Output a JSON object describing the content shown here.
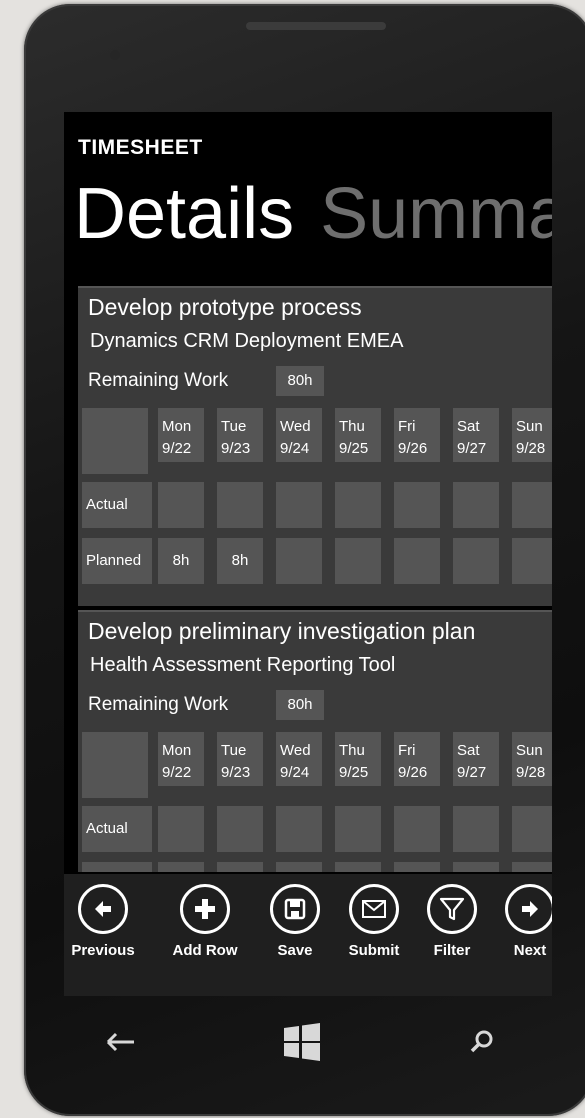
{
  "header": {
    "app_title": "TIMESHEET",
    "pivot_active": "Details",
    "pivot_next": "Summa"
  },
  "remaining_work_label": "Remaining Work",
  "row_labels": {
    "actual": "Actual",
    "planned": "Planned"
  },
  "days": [
    {
      "name": "Mon",
      "date": "9/22"
    },
    {
      "name": "Tue",
      "date": "9/23"
    },
    {
      "name": "Wed",
      "date": "9/24"
    },
    {
      "name": "Thu",
      "date": "9/25"
    },
    {
      "name": "Fri",
      "date": "9/26"
    },
    {
      "name": "Sat",
      "date": "9/27"
    },
    {
      "name": "Sun",
      "date": "9/28"
    }
  ],
  "tasks": [
    {
      "title": "Develop prototype process",
      "project": "Dynamics CRM Deployment EMEA",
      "remaining": "80h",
      "planned": [
        "8h",
        "8h",
        "",
        "",
        "",
        "",
        ""
      ],
      "actual": [
        "",
        "",
        "",
        "",
        "",
        "",
        ""
      ]
    },
    {
      "title": "Develop preliminary investigation plan",
      "project": "Health Assessment Reporting Tool",
      "remaining": "80h",
      "planned": [
        "",
        "",
        "",
        "",
        "",
        "",
        ""
      ],
      "actual": [
        "",
        "",
        "",
        "",
        "",
        "",
        ""
      ]
    }
  ],
  "appbar": {
    "previous": "Previous",
    "add_row": "Add Row",
    "save": "Save",
    "submit": "Submit",
    "filter": "Filter",
    "next": "Next"
  },
  "icons": {
    "previous": "arrow-left-icon",
    "add_row": "plus-icon",
    "save": "save-disk-icon",
    "submit": "envelope-icon",
    "filter": "filter-funnel-icon",
    "next": "arrow-right-icon",
    "hw_back": "back-arrow-icon",
    "hw_start": "windows-logo-icon",
    "hw_search": "search-icon"
  }
}
